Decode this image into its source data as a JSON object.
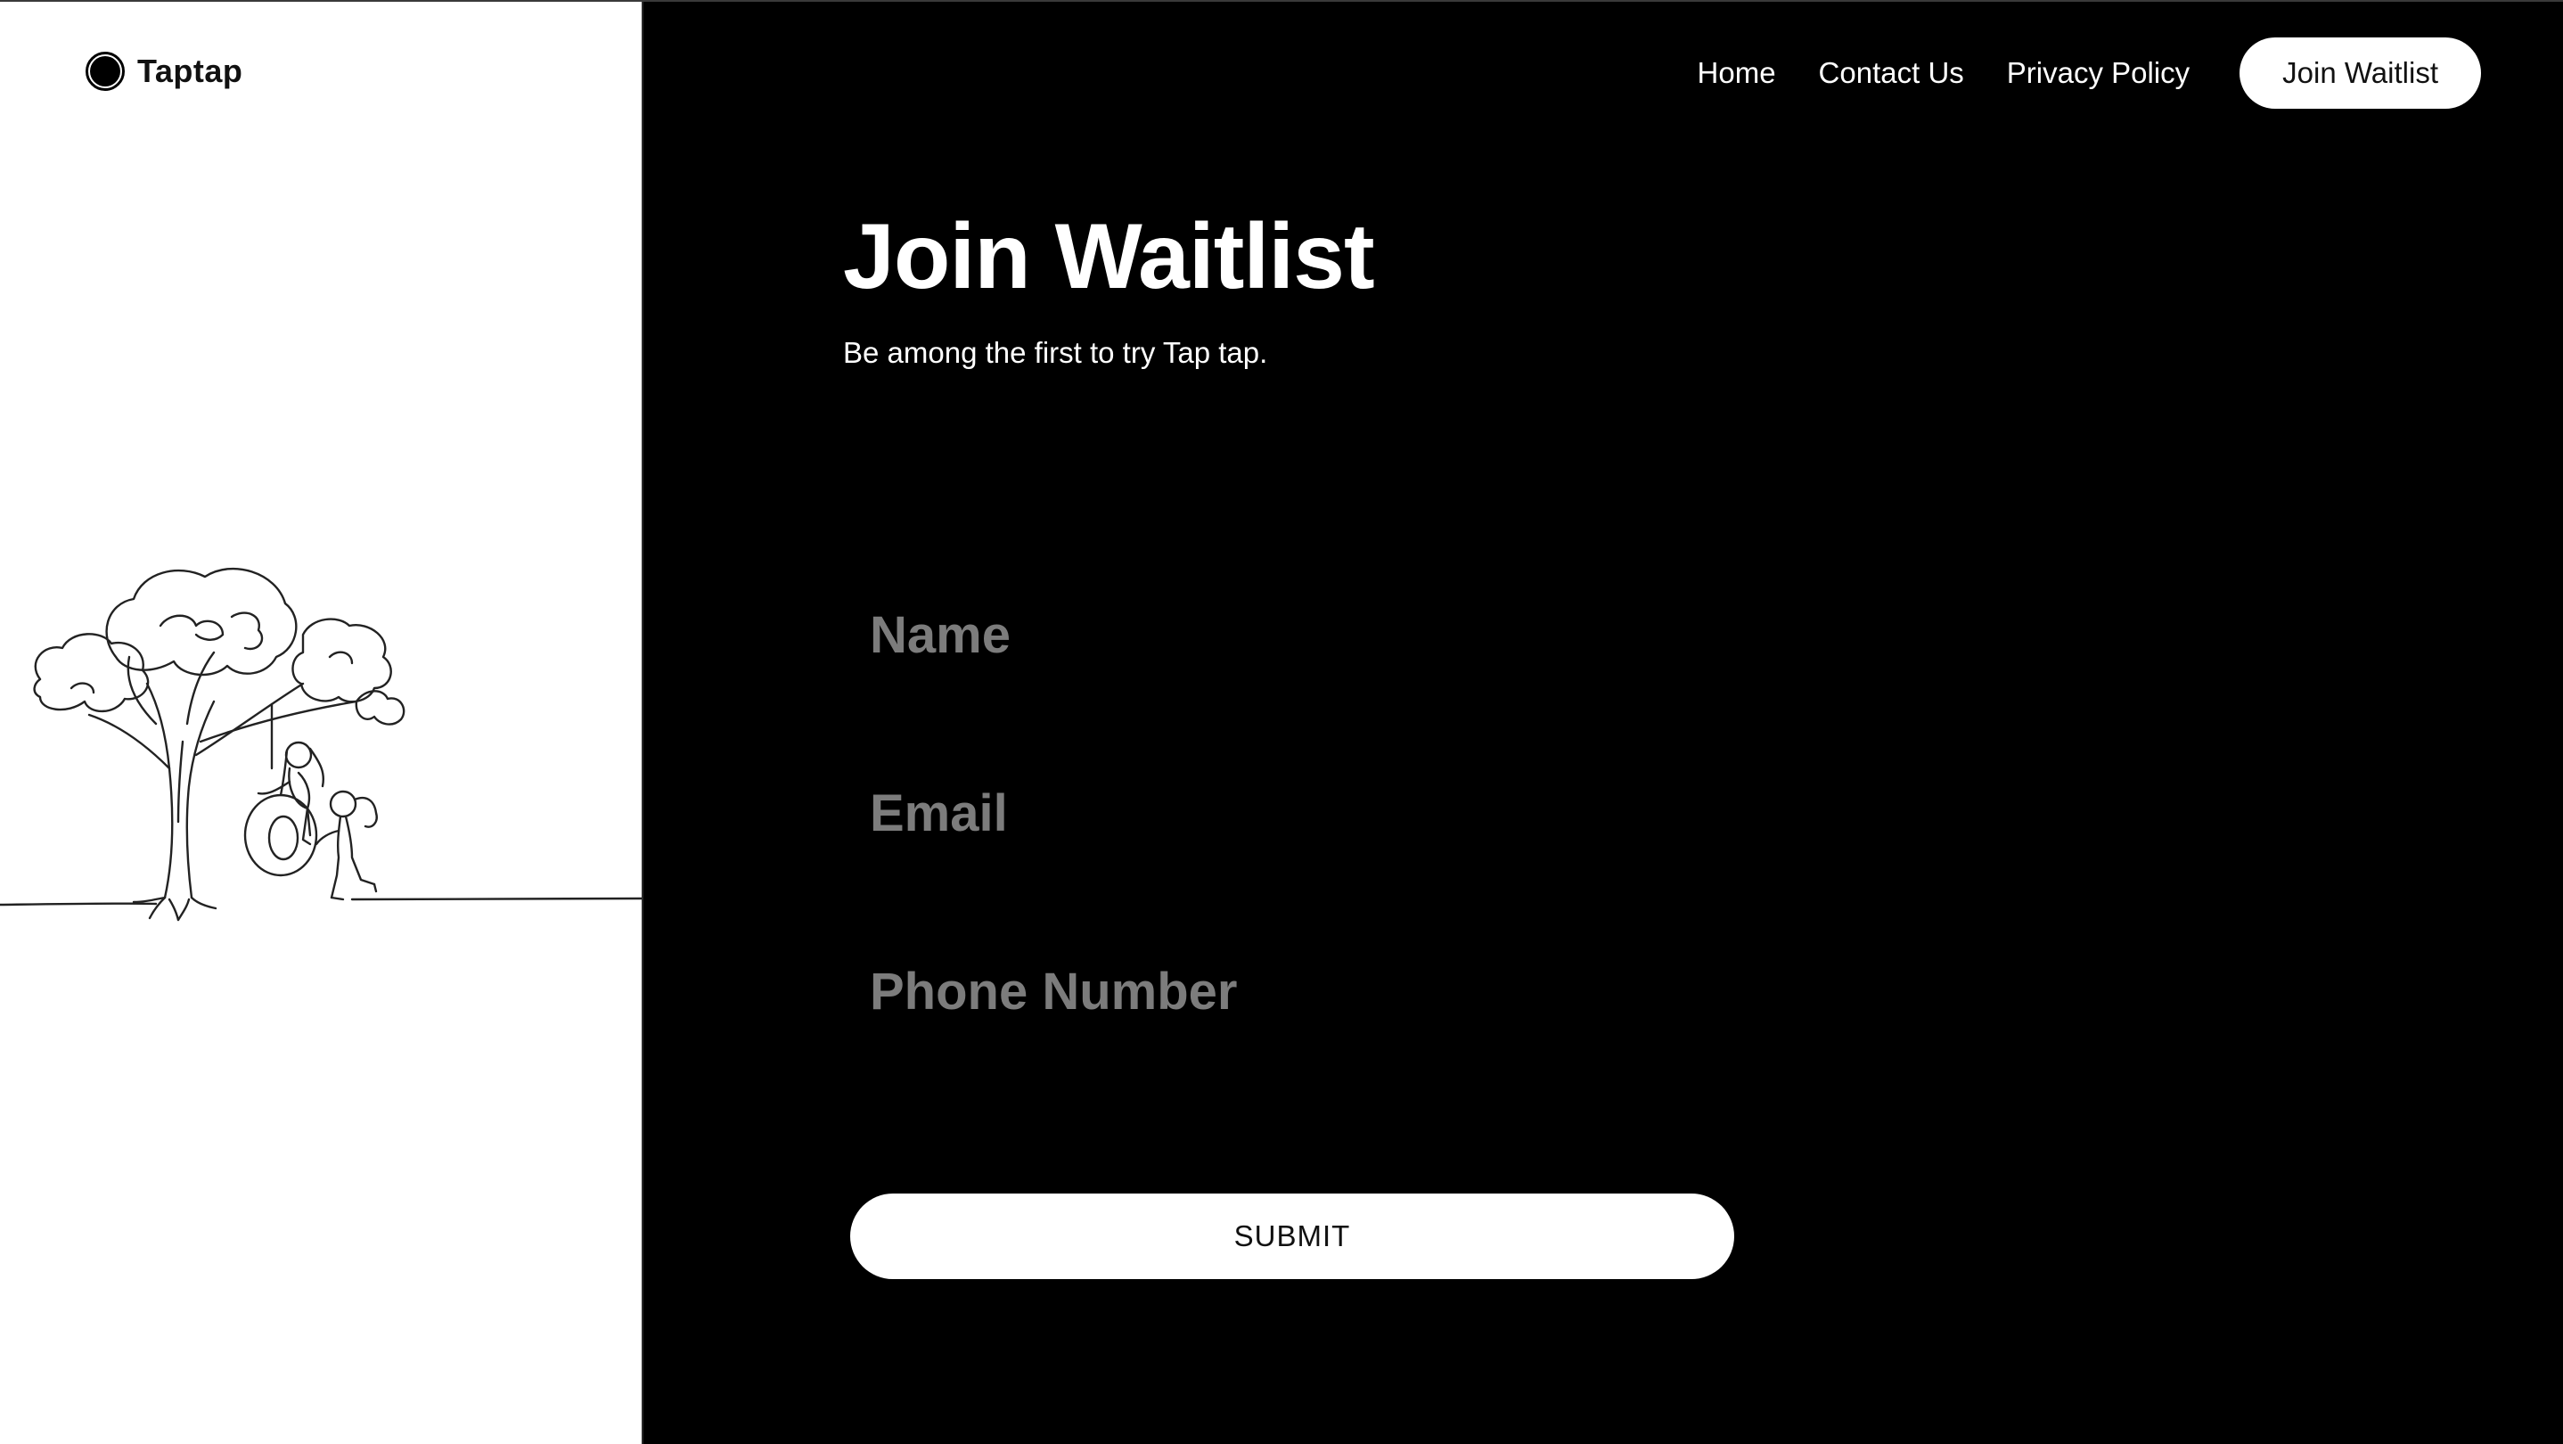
{
  "brand": {
    "name": "Taptap",
    "logo_icon": "circle-logo-icon"
  },
  "nav": {
    "items": [
      {
        "label": "Home"
      },
      {
        "label": "Contact Us"
      },
      {
        "label": "Privacy Policy"
      }
    ],
    "cta_label": "Join Waitlist"
  },
  "hero": {
    "title": "Join Waitlist",
    "subtitle": "Be among the first to try Tap tap."
  },
  "form": {
    "name": {
      "placeholder": "Name",
      "value": ""
    },
    "email": {
      "placeholder": "Email",
      "value": ""
    },
    "phone": {
      "placeholder": "Phone Number",
      "value": ""
    },
    "submit_label": "SUBMIT"
  },
  "illustration": {
    "icon": "tree-swing-children-illustration"
  },
  "colors": {
    "left_background": "#ffffff",
    "right_background": "#000000",
    "placeholder": "#7c7c7c",
    "button_background": "#ffffff"
  }
}
